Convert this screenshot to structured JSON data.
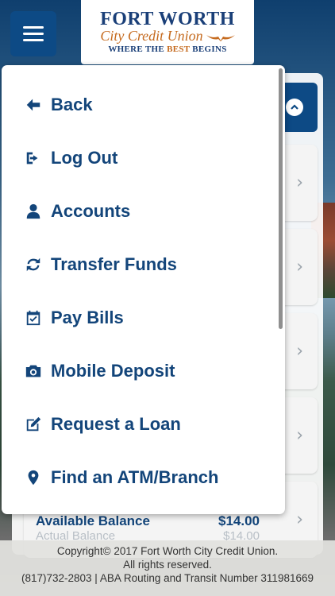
{
  "header": {
    "menu_icon": "hamburger-icon",
    "logo": {
      "line1": "FORT WORTH",
      "line2": "City Credit Union",
      "line3_pre": "WHERE THE ",
      "line3_em": "BEST",
      "line3_post": " BEGINS"
    }
  },
  "colors": {
    "brand_blue": "#13457a",
    "button_blue": "#0d4a85",
    "logo_orange": "#c56a1e"
  },
  "menu": {
    "items": [
      {
        "label": "Back",
        "icon": "arrow-left-icon"
      },
      {
        "label": "Log Out",
        "icon": "sign-out-icon"
      },
      {
        "label": "Accounts",
        "icon": "user-icon"
      },
      {
        "label": "Transfer Funds",
        "icon": "refresh-icon"
      },
      {
        "label": "Pay Bills",
        "icon": "calendar-check-icon"
      },
      {
        "label": "Mobile Deposit",
        "icon": "camera-icon"
      },
      {
        "label": "Request a Loan",
        "icon": "edit-icon"
      },
      {
        "label": "Find an ATM/Branch",
        "icon": "map-marker-icon"
      }
    ]
  },
  "account": {
    "available_label": "Available Balance",
    "available_value": "$14.00",
    "actual_label": "Actual Balance",
    "actual_value": "$14.00"
  },
  "footer": {
    "line1": "Copyright© 2017 Fort Worth City Credit Union.",
    "line2": "All rights reserved.",
    "line3": "(817)732-2803 | ABA Routing and Transit Number 311981669"
  }
}
